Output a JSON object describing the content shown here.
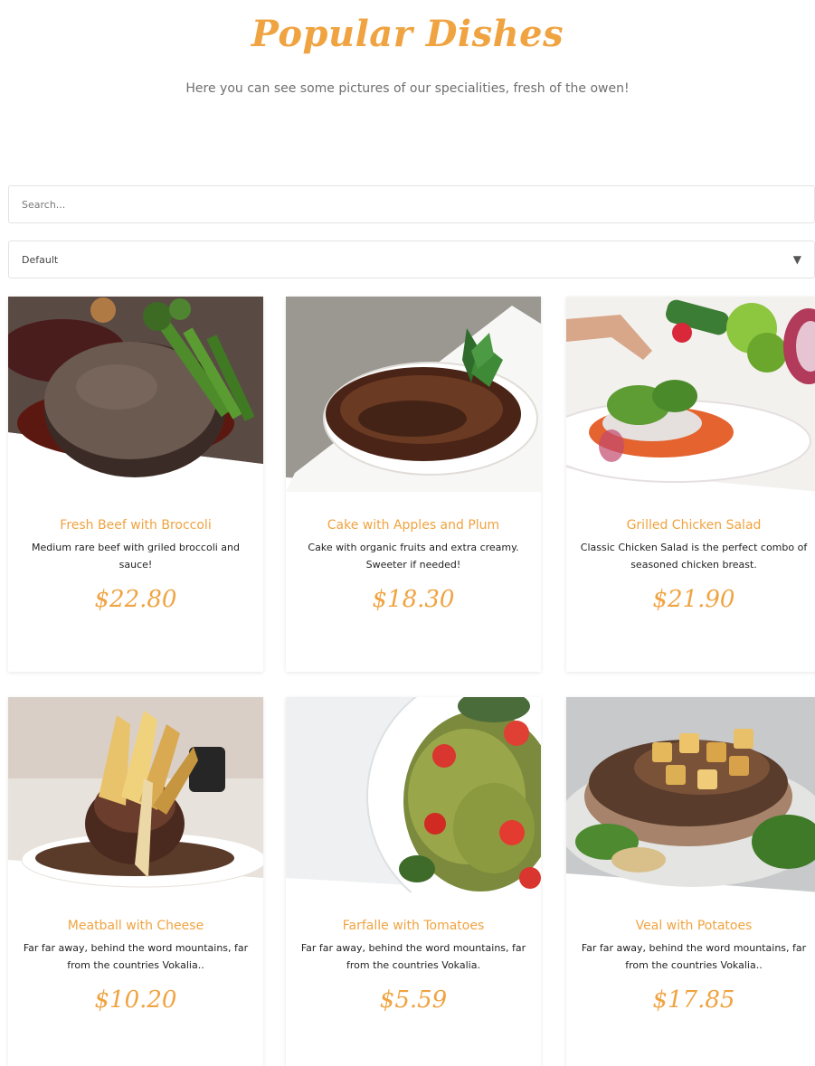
{
  "header": {
    "title": "Popular Dishes",
    "subtitle": "Here you can see some pictures of our specialities, fresh of the owen!"
  },
  "search": {
    "placeholder": "Search..."
  },
  "sort": {
    "selected": "Default",
    "icon": "chevron-down-icon"
  },
  "colors": {
    "accent": "#f0a341",
    "text": "#222222",
    "muted": "#6f6f6f"
  },
  "dishes": [
    {
      "name": "Fresh Beef with Broccoli",
      "description": "Medium rare beef with griled broccoli and sauce!",
      "price": "$22.80",
      "image": "beef-broccoli-photo"
    },
    {
      "name": "Cake with Apples and Plum",
      "description": "Cake with organic fruits and extra creamy. Sweeter if needed!",
      "price": "$18.30",
      "image": "creme-brulee-photo"
    },
    {
      "name": "Grilled Chicken Salad",
      "description": "Classic Chicken Salad is the perfect combo of seasoned chicken breast.",
      "price": "$21.90",
      "image": "salad-photo"
    },
    {
      "name": "Meatball with Cheese",
      "description": "Far far away, behind the word mountains, far from the countries Vokalia..",
      "price": "$10.20",
      "image": "meatball-photo"
    },
    {
      "name": "Farfalle with Tomatoes",
      "description": "Far far away, behind the word mountains, far from the countries Vokalia.",
      "price": "$5.59",
      "image": "farfalle-photo"
    },
    {
      "name": "Veal with Potatoes",
      "description": "Far far away, behind the word mountains, far from the countries Vokalia..",
      "price": "$17.85",
      "image": "veal-photo"
    }
  ]
}
